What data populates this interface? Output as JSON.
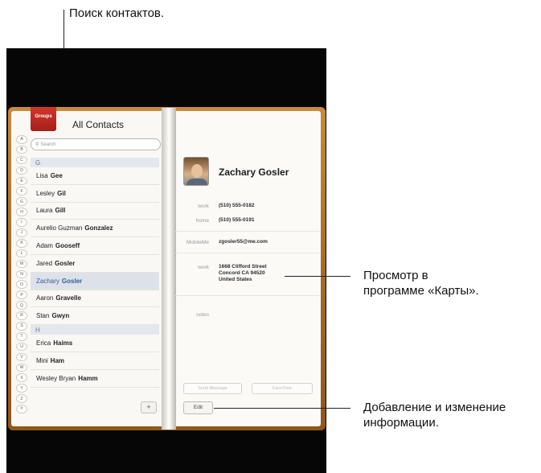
{
  "callouts": {
    "search": "Поиск контактов.",
    "maps": "Просмотр в\nпрограмме «Карты».",
    "maps_line1": "Просмотр в",
    "maps_line2": "программе «Карты».",
    "edit_line1": "Добавление и изменение",
    "edit_line2": "информации."
  },
  "left_page": {
    "groups_label": "Groups",
    "title": "All Contacts",
    "search_placeholder": "Search",
    "index_letters": [
      "A",
      "B",
      "C",
      "D",
      "E",
      "F",
      "G",
      "H",
      "I",
      "J",
      "K",
      "L",
      "M",
      "N",
      "O",
      "P",
      "Q",
      "R",
      "S",
      "T",
      "U",
      "V",
      "W",
      "X",
      "Y",
      "Z",
      "#"
    ],
    "sections": [
      {
        "header": "G",
        "contacts": [
          {
            "first": "Lisa",
            "last": "Gee"
          },
          {
            "first": "Lesley",
            "last": "Gil"
          },
          {
            "first": "Laura",
            "last": "Gill"
          },
          {
            "first": "Aurelio Guzman",
            "last": "Gonzalez"
          },
          {
            "first": "Adam",
            "last": "Gooseff"
          },
          {
            "first": "Jared",
            "last": "Gosler"
          },
          {
            "first": "Zachary",
            "last": "Gosler",
            "selected": true
          },
          {
            "first": "Aaron",
            "last": "Gravelle"
          },
          {
            "first": "Stan",
            "last": "Gwyn"
          }
        ]
      },
      {
        "header": "H",
        "contacts": [
          {
            "first": "Erica",
            "last": "Haims"
          },
          {
            "first": "Mini",
            "last": "Ham"
          },
          {
            "first": "Wesley Bryan",
            "last": "Hamm"
          }
        ]
      }
    ],
    "add_label": "+"
  },
  "right_page": {
    "name": "Zachary Gosler",
    "fields": {
      "work_phone_label": "work",
      "work_phone": "(510) 555-0182",
      "home_phone_label": "home",
      "home_phone": "(510) 555-0191",
      "mobileme_label": "MobileMe",
      "mobileme": "zgosler55@me.com",
      "address_label": "work",
      "address_line1": "1668 Clifford Street",
      "address_line2": "Concord CA 94520",
      "address_line3": "United States",
      "notes_label": "notes"
    },
    "send_message_label": "Send Message",
    "facetime_label": "FaceTime",
    "edit_label": "Edit"
  },
  "colors": {
    "cover": "#a86a26",
    "groups_tab": "#c22d22",
    "selected_text": "#2f5b9a",
    "section_header": "#e3e7ee"
  }
}
